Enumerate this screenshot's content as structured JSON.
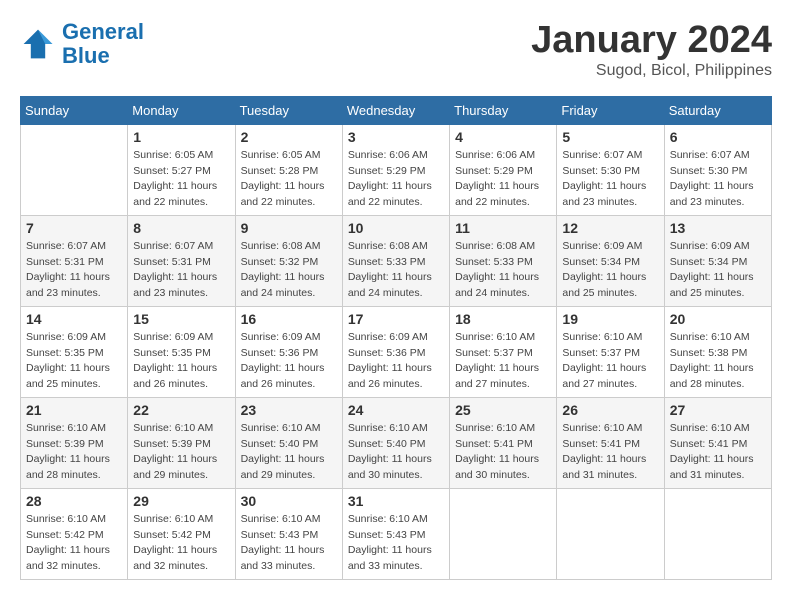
{
  "header": {
    "logo_line1": "General",
    "logo_line2": "Blue",
    "title": "January 2024",
    "subtitle": "Sugod, Bicol, Philippines"
  },
  "days_of_week": [
    "Sunday",
    "Monday",
    "Tuesday",
    "Wednesday",
    "Thursday",
    "Friday",
    "Saturday"
  ],
  "weeks": [
    [
      {
        "day": "",
        "info": ""
      },
      {
        "day": "1",
        "info": "Sunrise: 6:05 AM\nSunset: 5:27 PM\nDaylight: 11 hours\nand 22 minutes."
      },
      {
        "day": "2",
        "info": "Sunrise: 6:05 AM\nSunset: 5:28 PM\nDaylight: 11 hours\nand 22 minutes."
      },
      {
        "day": "3",
        "info": "Sunrise: 6:06 AM\nSunset: 5:29 PM\nDaylight: 11 hours\nand 22 minutes."
      },
      {
        "day": "4",
        "info": "Sunrise: 6:06 AM\nSunset: 5:29 PM\nDaylight: 11 hours\nand 22 minutes."
      },
      {
        "day": "5",
        "info": "Sunrise: 6:07 AM\nSunset: 5:30 PM\nDaylight: 11 hours\nand 23 minutes."
      },
      {
        "day": "6",
        "info": "Sunrise: 6:07 AM\nSunset: 5:30 PM\nDaylight: 11 hours\nand 23 minutes."
      }
    ],
    [
      {
        "day": "7",
        "info": "Sunrise: 6:07 AM\nSunset: 5:31 PM\nDaylight: 11 hours\nand 23 minutes."
      },
      {
        "day": "8",
        "info": "Sunrise: 6:07 AM\nSunset: 5:31 PM\nDaylight: 11 hours\nand 23 minutes."
      },
      {
        "day": "9",
        "info": "Sunrise: 6:08 AM\nSunset: 5:32 PM\nDaylight: 11 hours\nand 24 minutes."
      },
      {
        "day": "10",
        "info": "Sunrise: 6:08 AM\nSunset: 5:33 PM\nDaylight: 11 hours\nand 24 minutes."
      },
      {
        "day": "11",
        "info": "Sunrise: 6:08 AM\nSunset: 5:33 PM\nDaylight: 11 hours\nand 24 minutes."
      },
      {
        "day": "12",
        "info": "Sunrise: 6:09 AM\nSunset: 5:34 PM\nDaylight: 11 hours\nand 25 minutes."
      },
      {
        "day": "13",
        "info": "Sunrise: 6:09 AM\nSunset: 5:34 PM\nDaylight: 11 hours\nand 25 minutes."
      }
    ],
    [
      {
        "day": "14",
        "info": "Sunrise: 6:09 AM\nSunset: 5:35 PM\nDaylight: 11 hours\nand 25 minutes."
      },
      {
        "day": "15",
        "info": "Sunrise: 6:09 AM\nSunset: 5:35 PM\nDaylight: 11 hours\nand 26 minutes."
      },
      {
        "day": "16",
        "info": "Sunrise: 6:09 AM\nSunset: 5:36 PM\nDaylight: 11 hours\nand 26 minutes."
      },
      {
        "day": "17",
        "info": "Sunrise: 6:09 AM\nSunset: 5:36 PM\nDaylight: 11 hours\nand 26 minutes."
      },
      {
        "day": "18",
        "info": "Sunrise: 6:10 AM\nSunset: 5:37 PM\nDaylight: 11 hours\nand 27 minutes."
      },
      {
        "day": "19",
        "info": "Sunrise: 6:10 AM\nSunset: 5:37 PM\nDaylight: 11 hours\nand 27 minutes."
      },
      {
        "day": "20",
        "info": "Sunrise: 6:10 AM\nSunset: 5:38 PM\nDaylight: 11 hours\nand 28 minutes."
      }
    ],
    [
      {
        "day": "21",
        "info": "Sunrise: 6:10 AM\nSunset: 5:39 PM\nDaylight: 11 hours\nand 28 minutes."
      },
      {
        "day": "22",
        "info": "Sunrise: 6:10 AM\nSunset: 5:39 PM\nDaylight: 11 hours\nand 29 minutes."
      },
      {
        "day": "23",
        "info": "Sunrise: 6:10 AM\nSunset: 5:40 PM\nDaylight: 11 hours\nand 29 minutes."
      },
      {
        "day": "24",
        "info": "Sunrise: 6:10 AM\nSunset: 5:40 PM\nDaylight: 11 hours\nand 30 minutes."
      },
      {
        "day": "25",
        "info": "Sunrise: 6:10 AM\nSunset: 5:41 PM\nDaylight: 11 hours\nand 30 minutes."
      },
      {
        "day": "26",
        "info": "Sunrise: 6:10 AM\nSunset: 5:41 PM\nDaylight: 11 hours\nand 31 minutes."
      },
      {
        "day": "27",
        "info": "Sunrise: 6:10 AM\nSunset: 5:41 PM\nDaylight: 11 hours\nand 31 minutes."
      }
    ],
    [
      {
        "day": "28",
        "info": "Sunrise: 6:10 AM\nSunset: 5:42 PM\nDaylight: 11 hours\nand 32 minutes."
      },
      {
        "day": "29",
        "info": "Sunrise: 6:10 AM\nSunset: 5:42 PM\nDaylight: 11 hours\nand 32 minutes."
      },
      {
        "day": "30",
        "info": "Sunrise: 6:10 AM\nSunset: 5:43 PM\nDaylight: 11 hours\nand 33 minutes."
      },
      {
        "day": "31",
        "info": "Sunrise: 6:10 AM\nSunset: 5:43 PM\nDaylight: 11 hours\nand 33 minutes."
      },
      {
        "day": "",
        "info": ""
      },
      {
        "day": "",
        "info": ""
      },
      {
        "day": "",
        "info": ""
      }
    ]
  ]
}
